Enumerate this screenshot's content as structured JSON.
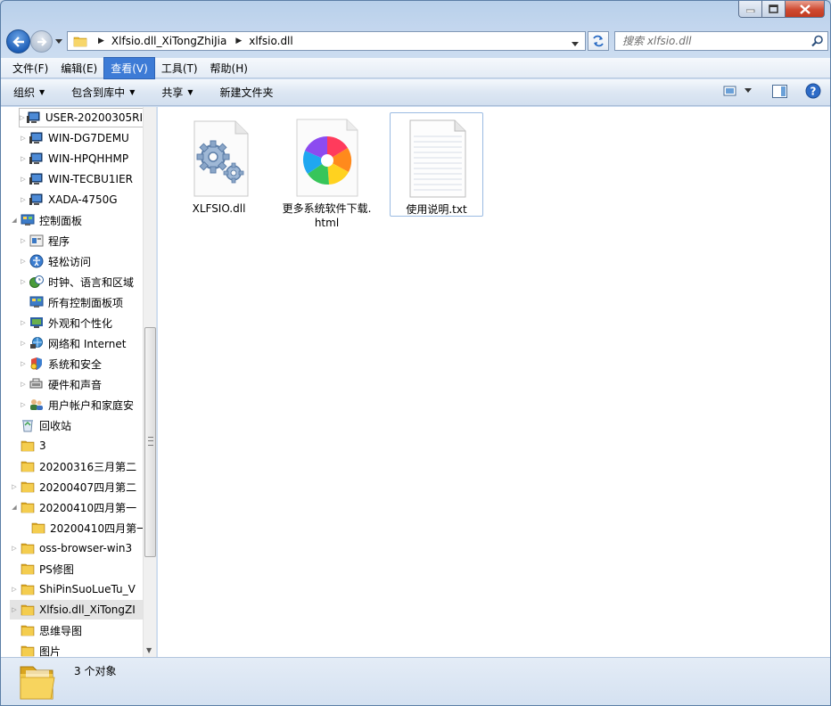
{
  "window": {
    "caption_buttons": [
      "minimize",
      "maximize",
      "close"
    ]
  },
  "address": {
    "crumbs": [
      "Xlfsio.dll_XiTongZhiJia",
      "xlfsio.dll"
    ],
    "search_placeholder": "搜索 xlfsio.dll"
  },
  "menubar": {
    "items": [
      "文件(F)",
      "编辑(E)",
      "查看(V)",
      "工具(T)",
      "帮助(H)"
    ],
    "active_index": 2
  },
  "cmdbar": {
    "organize": "组织",
    "include_library": "包含到库中",
    "share": "共享",
    "new_folder": "新建文件夹"
  },
  "navpane": {
    "items": [
      {
        "label": "USER-20200305RI",
        "icon": "computer-icon"
      },
      {
        "label": "WIN-DG7DEMU",
        "icon": "computer-icon"
      },
      {
        "label": "WIN-HPQHHMP",
        "icon": "computer-icon"
      },
      {
        "label": "WIN-TECBU1IER",
        "icon": "computer-icon"
      },
      {
        "label": "XADA-4750G",
        "icon": "computer-icon"
      },
      {
        "label": "控制面板",
        "icon": "control-panel-icon"
      },
      {
        "label": "程序",
        "icon": "programs-icon"
      },
      {
        "label": "轻松访问",
        "icon": "accessibility-icon"
      },
      {
        "label": "时钟、语言和区域",
        "icon": "clock-language-icon"
      },
      {
        "label": "所有控制面板项",
        "icon": "control-panel-icon"
      },
      {
        "label": "外观和个性化",
        "icon": "appearance-icon"
      },
      {
        "label": "网络和 Internet",
        "icon": "network-icon"
      },
      {
        "label": "系统和安全",
        "icon": "security-icon"
      },
      {
        "label": "硬件和声音",
        "icon": "hardware-icon"
      },
      {
        "label": "用户帐户和家庭安",
        "icon": "users-icon"
      },
      {
        "label": "回收站",
        "icon": "recycle-bin-icon"
      },
      {
        "label": "3",
        "icon": "folder-icon"
      },
      {
        "label": "20200316三月第二",
        "icon": "folder-icon"
      },
      {
        "label": "20200407四月第二",
        "icon": "folder-icon"
      },
      {
        "label": "20200410四月第一",
        "icon": "folder-icon"
      },
      {
        "label": "20200410四月第一",
        "icon": "folder-icon"
      },
      {
        "label": "oss-browser-win3",
        "icon": "folder-icon"
      },
      {
        "label": "PS修图",
        "icon": "folder-icon"
      },
      {
        "label": "ShiPinSuoLueTu_V",
        "icon": "folder-icon"
      },
      {
        "label": "Xlfsio.dll_XiTongZI",
        "icon": "folder-icon"
      },
      {
        "label": "思维导图",
        "icon": "folder-icon"
      },
      {
        "label": "图片",
        "icon": "folder-icon"
      }
    ]
  },
  "files": [
    {
      "name": "XLFSIO.dll",
      "icon": "dll-gear-icon"
    },
    {
      "name": "更多系统软件下载.html",
      "icon": "browser-icon"
    },
    {
      "name": "使用说明.txt",
      "icon": "text-file-icon"
    }
  ],
  "status": {
    "count_text": "3 个对象"
  },
  "colors": {
    "accent": "#3d7bd6",
    "folder": "#f0c440",
    "close_button": "#cf4a31"
  }
}
